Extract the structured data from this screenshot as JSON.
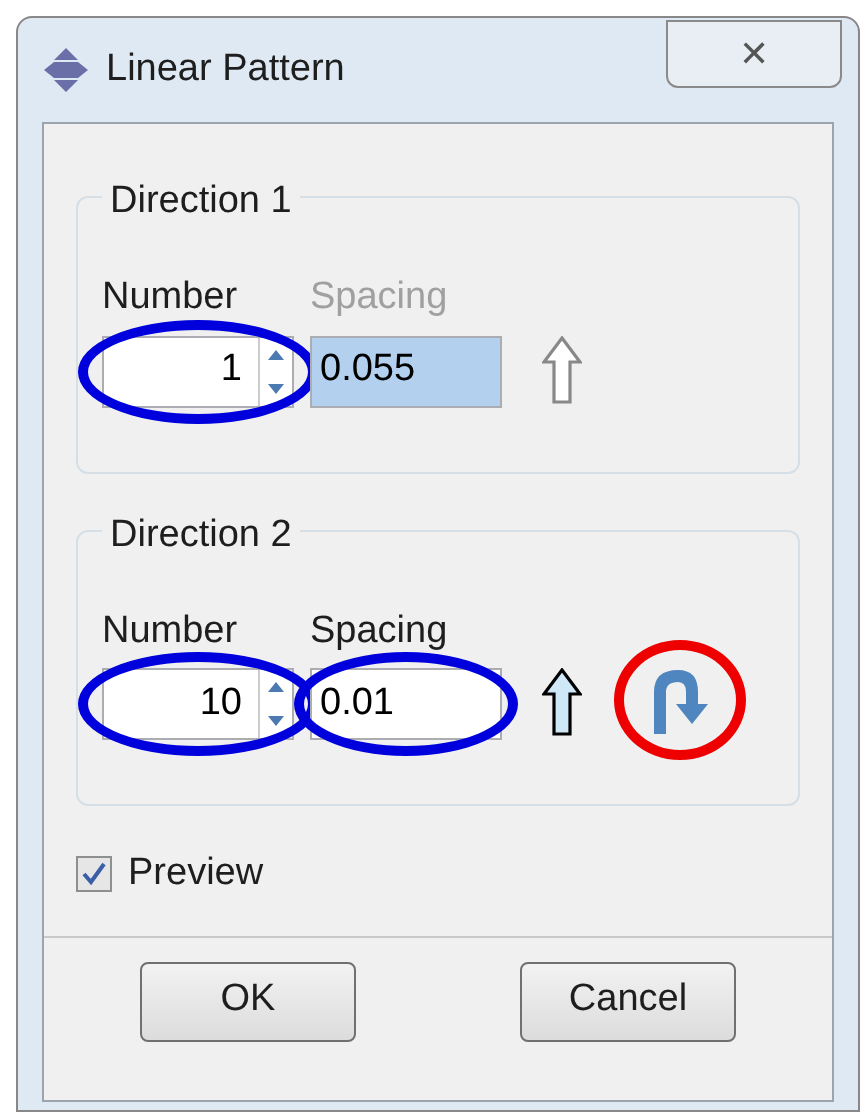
{
  "window": {
    "title": "Linear Pattern",
    "close": "✕"
  },
  "directions": [
    {
      "title": "Direction 1",
      "number_label": "Number",
      "number": "1",
      "number_circled": true,
      "spacing_label": "Spacing",
      "spacing_disabled": true,
      "spacing": "0.055",
      "spacing_highlighted": true,
      "spacing_circled": false,
      "arrow_active": false,
      "reverse_button": false
    },
    {
      "title": "Direction 2",
      "number_label": "Number",
      "number": "10",
      "number_circled": true,
      "spacing_label": "Spacing",
      "spacing_disabled": false,
      "spacing": "0.01",
      "spacing_highlighted": false,
      "spacing_circled": true,
      "arrow_active": true,
      "reverse_button": true
    }
  ],
  "preview": {
    "label": "Preview",
    "checked": true
  },
  "buttons": [
    "OK",
    "Cancel"
  ]
}
